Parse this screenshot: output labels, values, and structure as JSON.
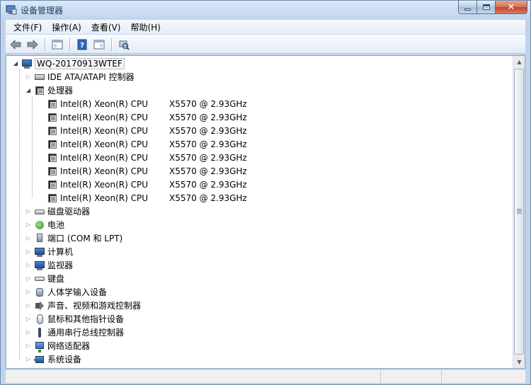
{
  "window": {
    "title": "设备管理器",
    "controls": {
      "minimize": "minimize",
      "maximize": "maximize",
      "close": "✕"
    }
  },
  "menu": [
    "文件(F)",
    "操作(A)",
    "查看(V)",
    "帮助(H)"
  ],
  "toolbar": {
    "buttons": [
      "back-icon",
      "forward-icon",
      "show-hide-console-tree-icon",
      "help-icon",
      "properties-icon",
      "scan-hardware-icon"
    ]
  },
  "tree": {
    "root": "WQ-20170913WTEF",
    "categories": {
      "ide": "IDE ATA/ATAPI 控制器",
      "processors": "处理器",
      "disk_drives": "磁盘驱动器",
      "battery": "电池",
      "ports": "端口 (COM 和 LPT)",
      "computer": "计算机",
      "monitors": "监视器",
      "keyboards": "键盘",
      "hid": "人体学输入设备",
      "sound": "声音、视频和游戏控制器",
      "mice": "鼠标和其他指针设备",
      "usb": "通用串行总线控制器",
      "network": "网络适配器",
      "system": "系统设备"
    },
    "processors": [
      {
        "name": "Intel(R) Xeon(R) CPU",
        "model": "X5570  @ 2.93GHz"
      },
      {
        "name": "Intel(R) Xeon(R) CPU",
        "model": "X5570  @ 2.93GHz"
      },
      {
        "name": "Intel(R) Xeon(R) CPU",
        "model": "X5570  @ 2.93GHz"
      },
      {
        "name": "Intel(R) Xeon(R) CPU",
        "model": "X5570  @ 2.93GHz"
      },
      {
        "name": "Intel(R) Xeon(R) CPU",
        "model": "X5570  @ 2.93GHz"
      },
      {
        "name": "Intel(R) Xeon(R) CPU",
        "model": "X5570  @ 2.93GHz"
      },
      {
        "name": "Intel(R) Xeon(R) CPU",
        "model": "X5570  @ 2.93GHz"
      },
      {
        "name": "Intel(R) Xeon(R) CPU",
        "model": "X5570  @ 2.93GHz"
      }
    ]
  },
  "colors": {
    "title_text": "#1e395b",
    "window_frame": "#c3d6ee",
    "close_button": "#c4442a"
  }
}
